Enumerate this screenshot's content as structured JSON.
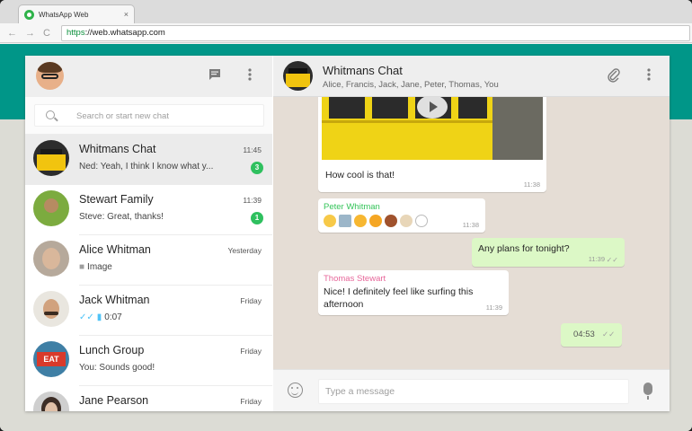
{
  "browser": {
    "tab_title": "WhatsApp Web",
    "tab_close": "×",
    "nav_back": "←",
    "nav_forward": "→",
    "nav_reload": "C",
    "url_scheme": "https",
    "url_rest": "://web.whatsapp.com"
  },
  "sidebar": {
    "search_placeholder": "Search or start new chat",
    "header_icons": [
      "chat-icon",
      "menu-icon"
    ],
    "chats": [
      {
        "name": "Whitmans Chat",
        "time": "11:45",
        "preview": "Ned: Yeah, I think I know what y...",
        "unread": "3"
      },
      {
        "name": "Stewart Family",
        "time": "11:39",
        "preview": "Steve: Great, thanks!",
        "unread": "1"
      },
      {
        "name": "Alice Whitman",
        "time": "Yesterday",
        "preview": "Image"
      },
      {
        "name": "Jack Whitman",
        "time": "Friday",
        "preview": "0:07"
      },
      {
        "name": "Lunch Group",
        "time": "Friday",
        "preview": "You: Sounds good!"
      },
      {
        "name": "Jane Pearson",
        "time": "Friday",
        "preview": ""
      }
    ],
    "lunch_sign": "EAT"
  },
  "conversation": {
    "title": "Whitmans Chat",
    "members": "Alice, Francis, Jack, Jane, Peter, Thomas, You",
    "header_icons": [
      "attach-icon",
      "menu-icon"
    ],
    "messages": {
      "photo_caption": "How cool is that!",
      "photo_time": "11:38",
      "peter_sender": "Peter Whitman",
      "peter_time": "11:38",
      "plans_text": "Any plans for tonight?",
      "plans_time": "11:39",
      "thomas_sender": "Thomas Stewart",
      "thomas_line1": "Nice! I definitely feel like surfing this",
      "thomas_line2": "afternoon",
      "thomas_time": "11:39",
      "voice_duration": "04:53"
    },
    "composer_placeholder": "Type a message"
  },
  "colors": {
    "accent_teal": "#009688",
    "unread_badge": "#2fc05f",
    "outgoing_bubble": "#dcf8c6",
    "peter_name": "#35c45a",
    "thomas_name": "#e7679a",
    "read_ticks": "#4fc3f7"
  }
}
